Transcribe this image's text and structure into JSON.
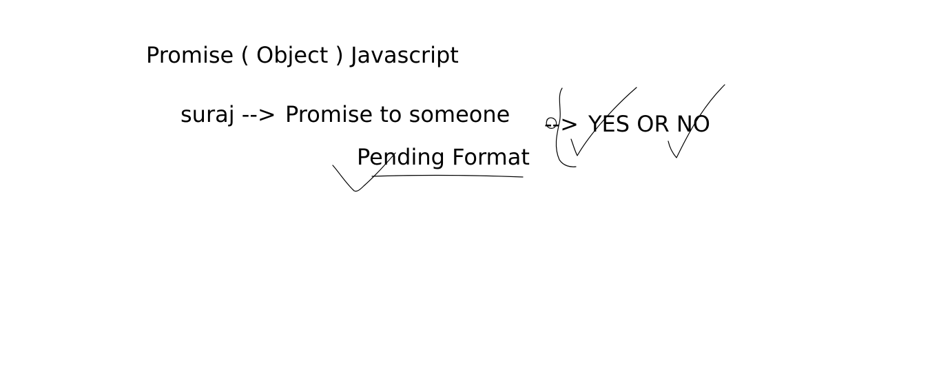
{
  "note": {
    "title": "Promise ( Object ) Javascript",
    "line1": {
      "subject": "suraj -->",
      "object": "Promise to someone"
    },
    "line2": {
      "arrow": "-->",
      "answer": "YES OR NO"
    },
    "state": "Pending Format"
  },
  "colors": {
    "background": "#ffffff",
    "text": "#000000",
    "ink": "#000000"
  },
  "icons": [
    "checkmark-icon",
    "underline-stroke",
    "bracket-stroke"
  ]
}
